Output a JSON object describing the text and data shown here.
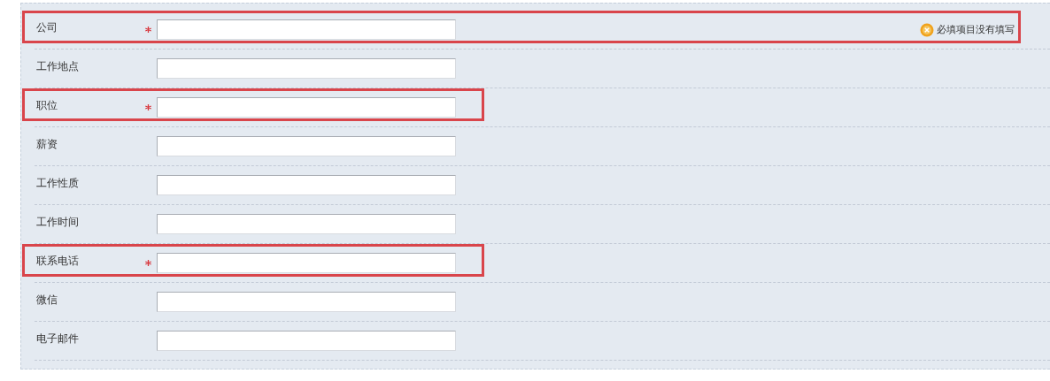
{
  "fields": [
    {
      "label": "公司",
      "required": true,
      "highlighted": true,
      "error": "必填项目没有填写"
    },
    {
      "label": "工作地点",
      "required": false,
      "highlighted": false
    },
    {
      "label": "职位",
      "required": true,
      "highlighted": true
    },
    {
      "label": "薪资",
      "required": false,
      "highlighted": false
    },
    {
      "label": "工作性质",
      "required": false,
      "highlighted": false
    },
    {
      "label": "工作时间",
      "required": false,
      "highlighted": false
    },
    {
      "label": "联系电话",
      "required": true,
      "highlighted": true
    },
    {
      "label": "微信",
      "required": false,
      "highlighted": false
    },
    {
      "label": "电子邮件",
      "required": false,
      "highlighted": false
    }
  ]
}
